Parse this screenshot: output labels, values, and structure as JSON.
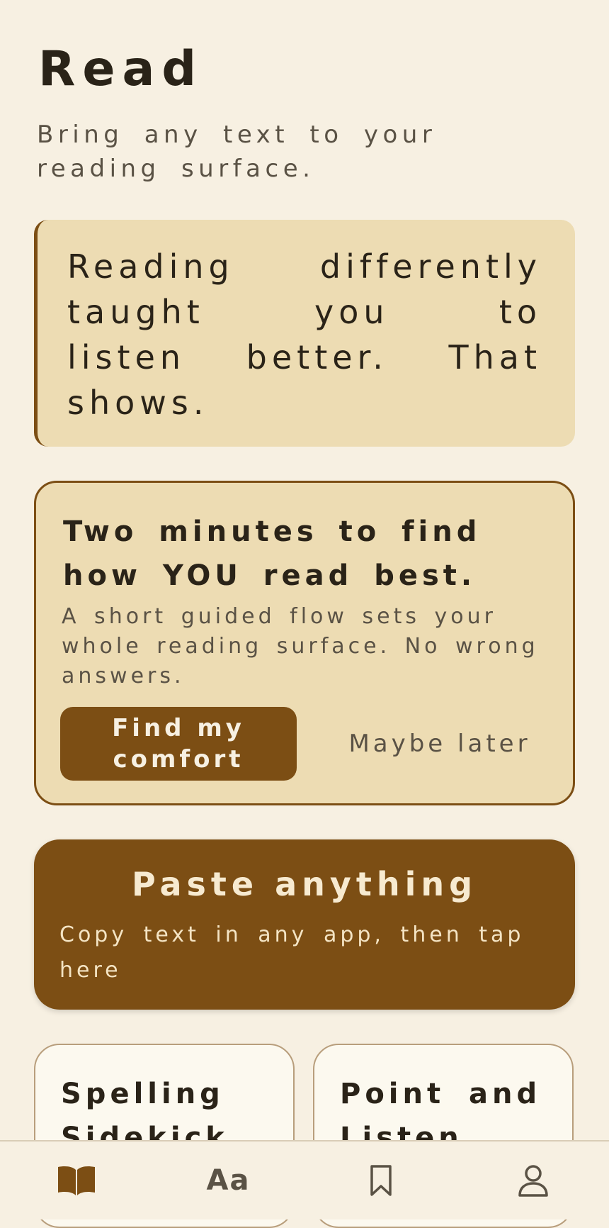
{
  "header": {
    "title": "Read",
    "subtitle": "Bring any text to your reading surface."
  },
  "quote_card": {
    "text": "Reading differently taught you to listen better. That shows."
  },
  "onboarding_card": {
    "heading": "Two minutes to find how YOU read best.",
    "description": "A short guided flow sets your whole reading surface. No wrong answers.",
    "primary_button": "Find my comfort",
    "secondary_button": "Maybe later"
  },
  "paste_card": {
    "title": "Paste anything",
    "subtitle": "Copy text in any app, then tap here"
  },
  "tool_cards": [
    {
      "title": "Spelling Sidekick"
    },
    {
      "title": "Point and Listen"
    }
  ],
  "tab_bar": {
    "tabs": [
      {
        "icon": "open-book-icon",
        "active": true
      },
      {
        "icon": "text-style-icon",
        "label": "Aa",
        "active": false
      },
      {
        "icon": "bookmark-icon",
        "active": false
      },
      {
        "icon": "person-icon",
        "active": false
      }
    ]
  },
  "colors": {
    "background": "#f7f0e2",
    "card": "#eddcb3",
    "accent": "#7c4e14",
    "text": "#2a2318",
    "muted_text": "#5a5245"
  }
}
